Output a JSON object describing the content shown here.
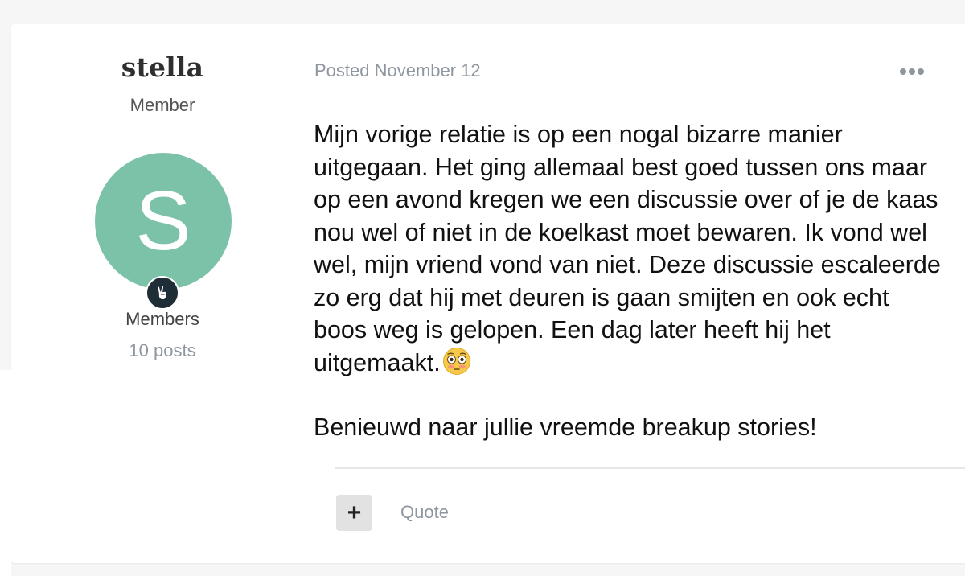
{
  "author": {
    "name": "stella",
    "title": "Member",
    "avatar_letter": "S",
    "avatar_color": "#7cc2a9",
    "badge_icon": "hand-peace-icon",
    "group": "Members",
    "posts": "10 posts"
  },
  "post": {
    "date": "Posted November 12",
    "more_icon": "ellipsis-icon",
    "paragraphs": [
      "Mijn vorige relatie is op een nogal bizarre manier uitgegaan. Het ging allemaal best goed tussen ons maar op een avond kregen we een discussie over of je de kaas nou wel of niet in de koelkast moet bewaren. Ik vond wel wel, mijn vriend vond van niet. Deze discussie escaleerde zo erg dat hij met deuren is gaan smijten en ook echt boos weg is gelopen. Een dag later heeft hij het uitgemaakt.",
      "Benieuwd naar jullie vreemde breakup stories!"
    ],
    "emoji": "flushed-face-emoji"
  },
  "actions": {
    "plus_label": "+",
    "quote_label": "Quote"
  }
}
